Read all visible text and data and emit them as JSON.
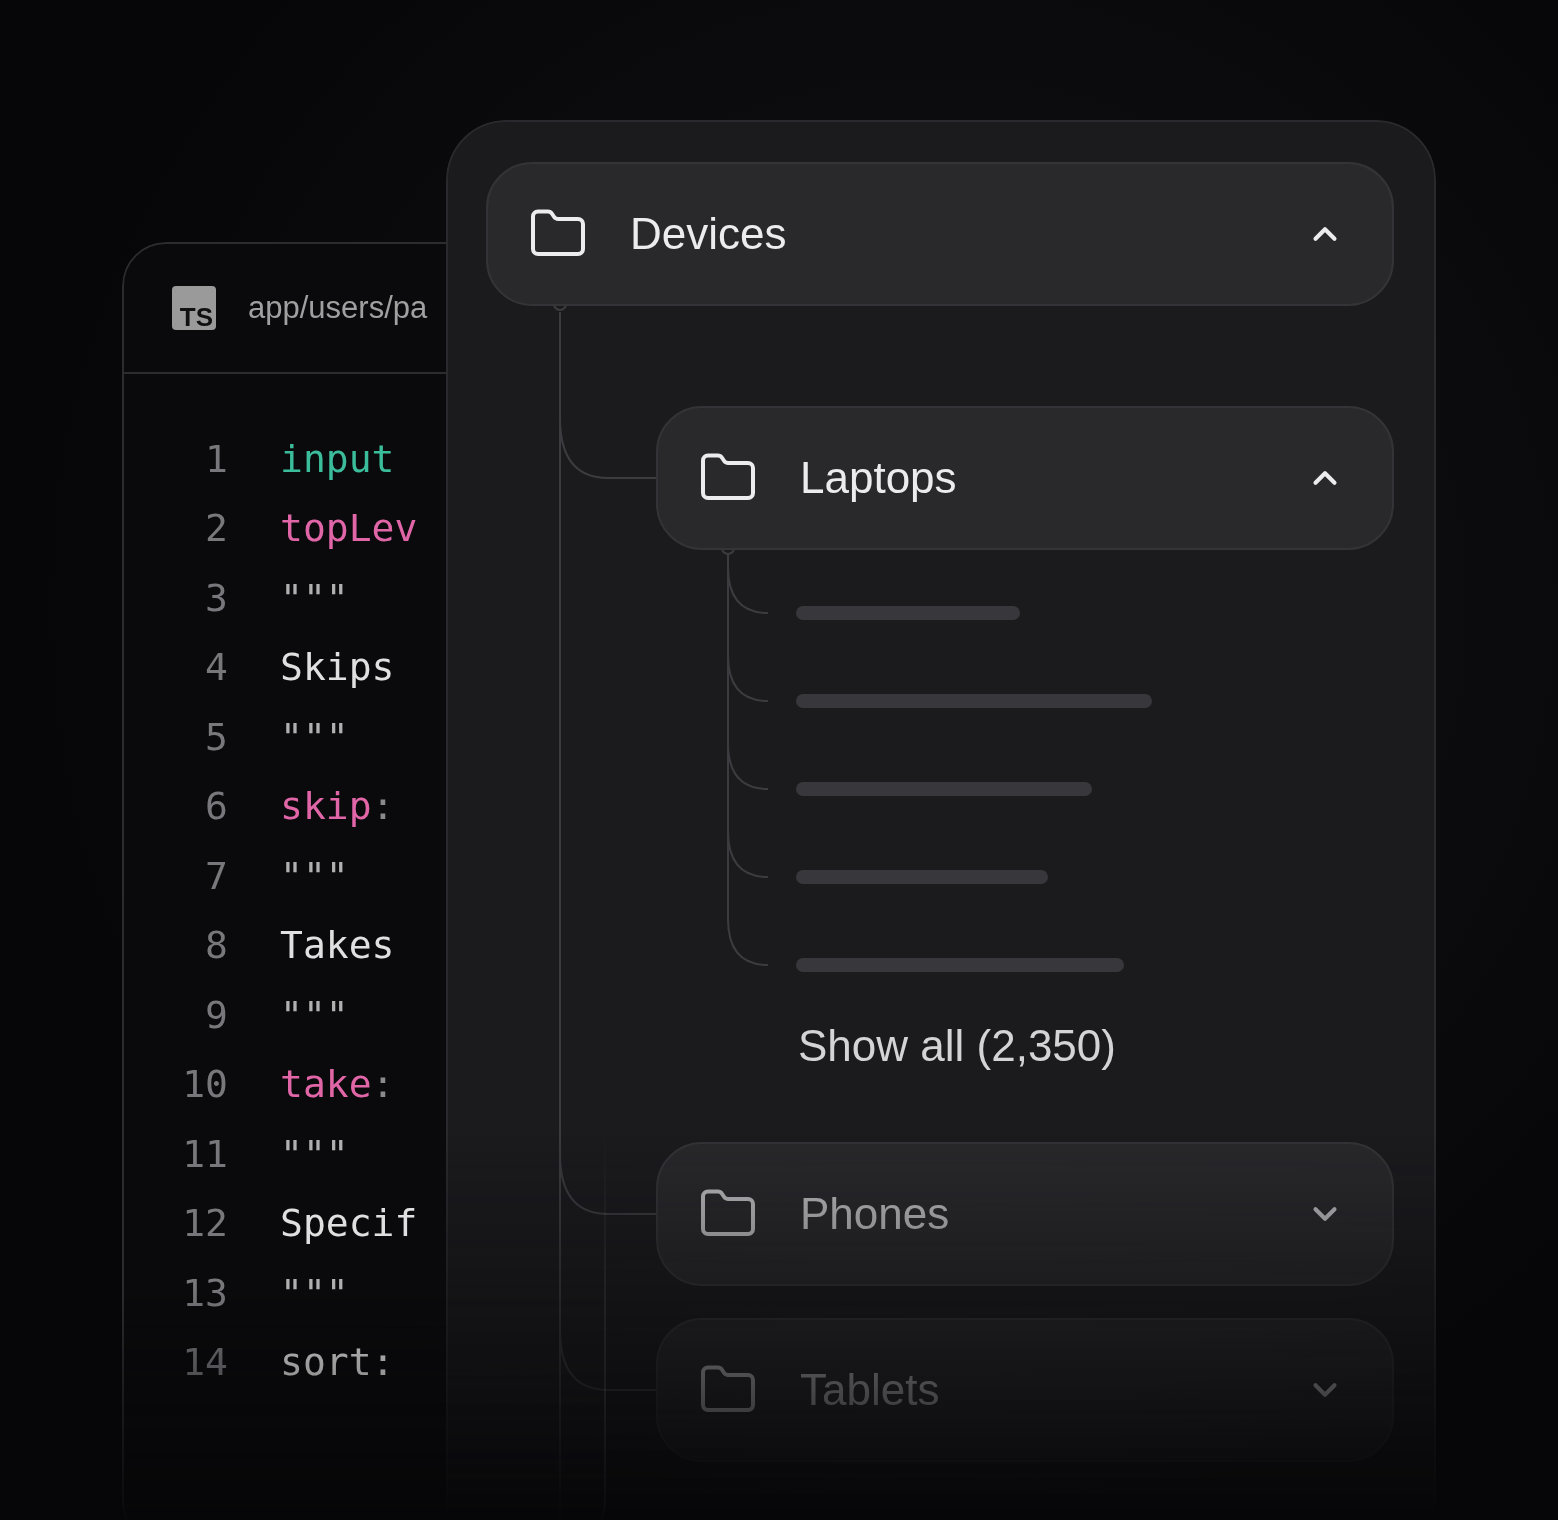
{
  "editor": {
    "file_type_badge": "TS",
    "file_path": "app/users/pa",
    "lines": [
      {
        "number": "1",
        "tokens": [
          {
            "text": "input",
            "kind": "keyword"
          }
        ]
      },
      {
        "number": "2",
        "tokens": [
          {
            "text": "topLev",
            "kind": "key"
          }
        ]
      },
      {
        "number": "3",
        "tokens": [
          {
            "text": "\"\"\"",
            "kind": "quote"
          }
        ]
      },
      {
        "number": "4",
        "tokens": [
          {
            "text": "Skips",
            "kind": "doc"
          }
        ]
      },
      {
        "number": "5",
        "tokens": [
          {
            "text": "\"\"\"",
            "kind": "quote"
          }
        ]
      },
      {
        "number": "6",
        "tokens": [
          {
            "text": "skip",
            "kind": "key"
          },
          {
            "text": ":",
            "kind": "punct"
          }
        ]
      },
      {
        "number": "7",
        "tokens": [
          {
            "text": "\"\"\"",
            "kind": "quote"
          }
        ]
      },
      {
        "number": "8",
        "tokens": [
          {
            "text": "Takes",
            "kind": "doc"
          }
        ]
      },
      {
        "number": "9",
        "tokens": [
          {
            "text": "\"\"\"",
            "kind": "quote"
          }
        ]
      },
      {
        "number": "10",
        "tokens": [
          {
            "text": "take",
            "kind": "key"
          },
          {
            "text": ":",
            "kind": "punct"
          }
        ]
      },
      {
        "number": "11",
        "tokens": [
          {
            "text": "\"\"\"",
            "kind": "quote"
          }
        ]
      },
      {
        "number": "12",
        "tokens": [
          {
            "text": "Specif",
            "kind": "doc"
          }
        ]
      },
      {
        "number": "13",
        "tokens": [
          {
            "text": "\"\"\"",
            "kind": "quote"
          }
        ]
      },
      {
        "number": "14",
        "tokens": [
          {
            "text": "sort:",
            "kind": "doc"
          }
        ]
      }
    ]
  },
  "tree": {
    "label": "Devices",
    "expanded": true,
    "children": [
      {
        "label": "Laptops",
        "expanded": true,
        "show_all": "Show all (2,350)"
      },
      {
        "label": "Phones",
        "expanded": false
      },
      {
        "label": "Tablets",
        "expanded": false
      }
    ]
  }
}
